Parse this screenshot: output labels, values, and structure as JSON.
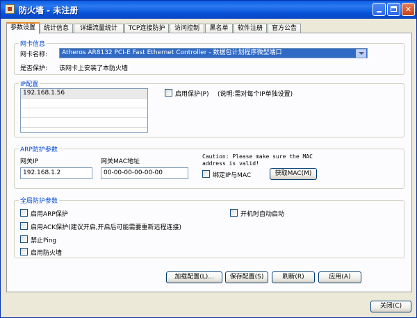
{
  "window": {
    "title": "防火墙 - 未注册"
  },
  "tabs": [
    "参数设置",
    "统计信息",
    "详细流量统计",
    "TCP连接防护",
    "访问控制",
    "黑名单",
    "软件注册",
    "官方公告"
  ],
  "nic": {
    "group_title": "网卡信息",
    "name_label": "网卡名称:",
    "name_value": "Atheros AR8132 PCI-E Fast Ethernet Controller - 数据包计划程序微型端口",
    "protected_label": "是否保护:",
    "protected_value": "该网卡上安装了本防火墙"
  },
  "ip": {
    "group_title": "IP配置",
    "list": [
      "192.168.1.56",
      "",
      "",
      "",
      "",
      ""
    ],
    "enable_protect_label": "启用保护(P)",
    "note": "(说明:需对每个IP单独设置)"
  },
  "arp": {
    "group_title": "ARP防护参数",
    "gateway_ip_label": "网关IP",
    "gateway_ip_value": "192.168.1.2",
    "gateway_mac_label": "网关MAC地址",
    "gateway_mac_value": "00-00-00-00-00-00",
    "caution_line1": "Caution: Please make sure the MAC",
    "caution_line2": "address is valid!",
    "bind_label": "绑定IP与MAC",
    "get_mac_button": "获取MAC(M)"
  },
  "global": {
    "group_title": "全局防护参数",
    "enable_arp": "启用ARP保护",
    "autostart": "开机时自动启动",
    "enable_ack": "启用ACK保护(建议开启,开启后可能需要重新远程连接)",
    "disable_ping": "禁止Ping",
    "enable_firewall": "启用防火墙"
  },
  "buttons": {
    "load": "加载配置(L)...",
    "save": "保存配置(S)",
    "refresh": "刷新(R)",
    "apply": "应用(A)",
    "close": "关闭(C)"
  }
}
